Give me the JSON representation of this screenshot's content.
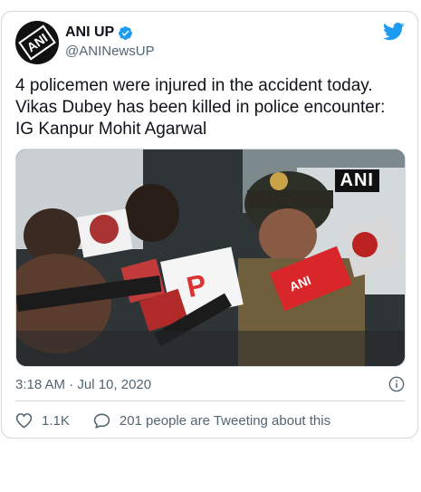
{
  "account": {
    "name": "ANI UP",
    "handle": "@ANINewsUP",
    "avatar_text": "ANI"
  },
  "tweet": {
    "text": "4 policemen were injured in the accident today. Vikas Dubey has been killed in police encounter: IG Kanpur Mohit Agarwal",
    "timestamp": "3:18 AM · Jul 10, 2020",
    "media_watermark": "ANI"
  },
  "engagement": {
    "likes": "1.1K",
    "conversation": "201 people are Tweeting about this"
  },
  "icons": {
    "verified": "verified-badge-icon",
    "bird": "twitter-bird-icon",
    "info": "info-icon",
    "heart": "heart-icon",
    "reply": "reply-bubble-icon"
  },
  "colors": {
    "brand": "#1d9bf0",
    "text": "#0f1419",
    "muted": "#536471",
    "border": "#cfd9de"
  }
}
